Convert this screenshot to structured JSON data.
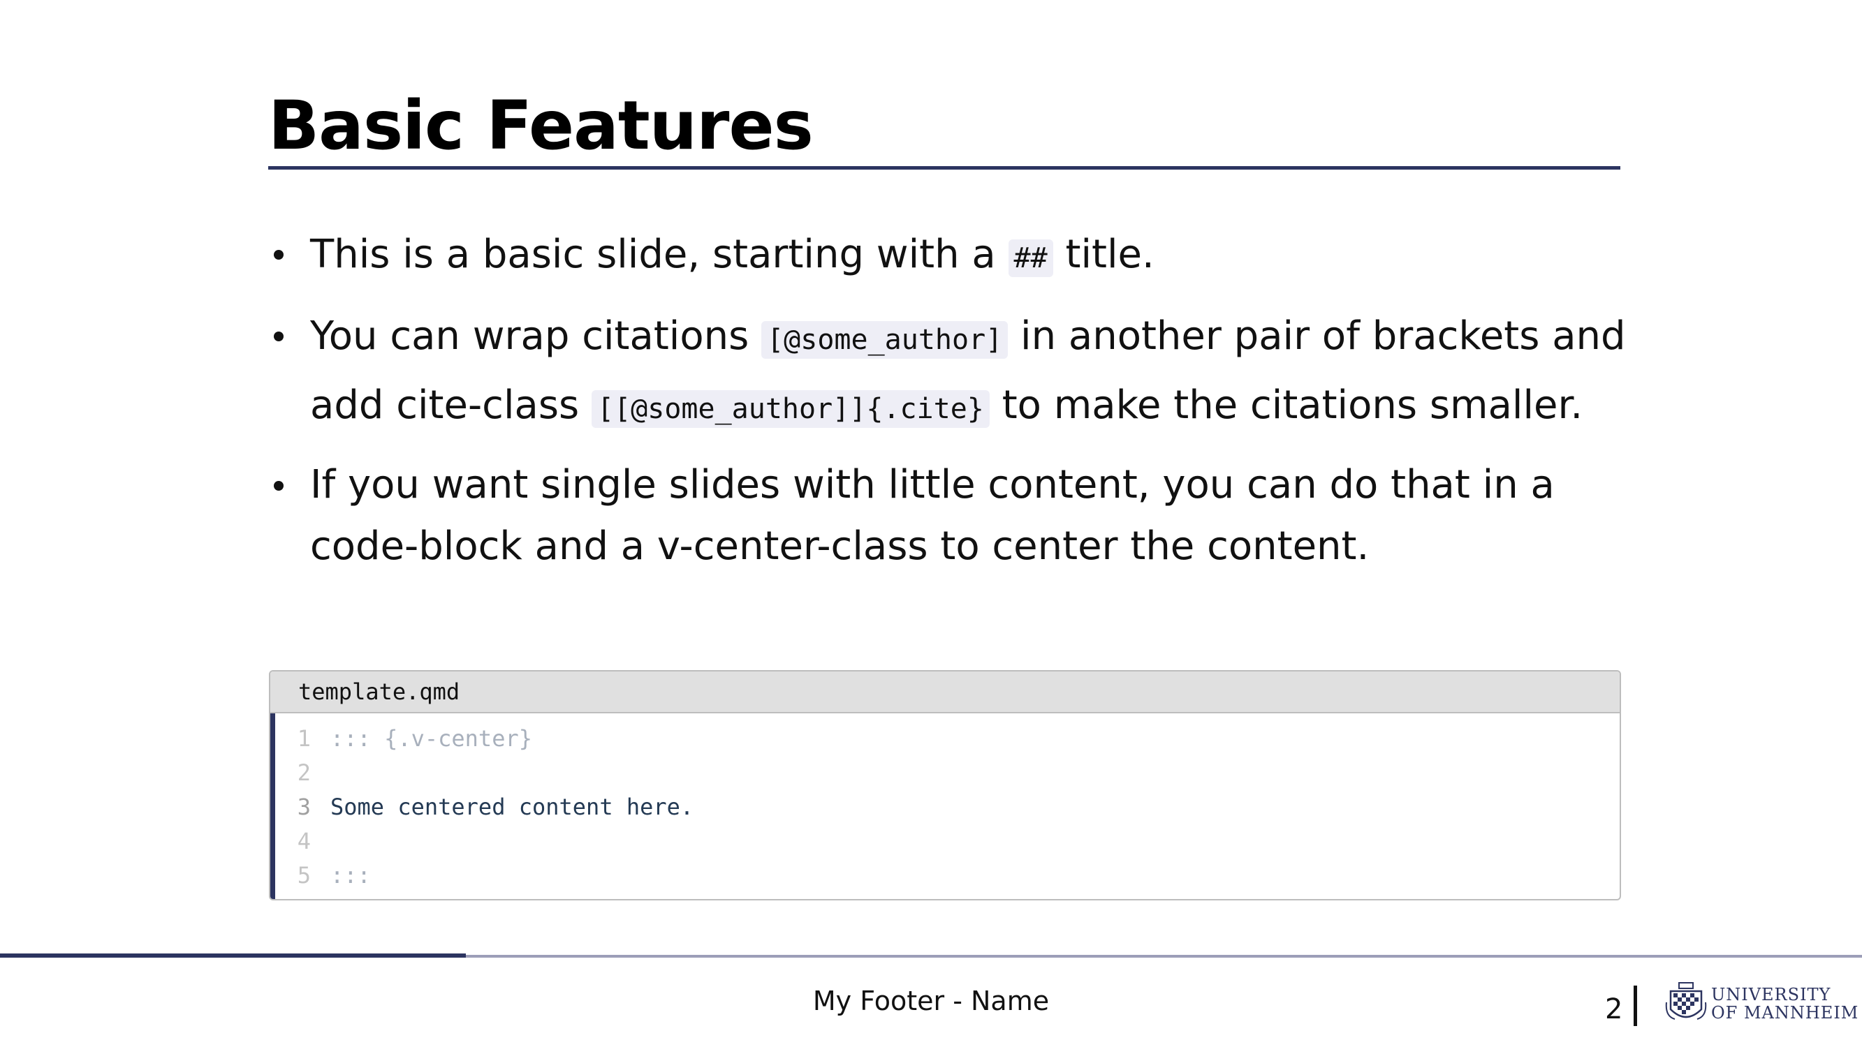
{
  "slide": {
    "title": "Basic Features",
    "bullets": [
      {
        "pre": "This is a basic slide, starting with a ",
        "code": "##",
        "post": " title."
      },
      {
        "pre": "You can wrap citations ",
        "code": "[@some_author]",
        "mid": " in another pair of brackets and add cite-class ",
        "code2": "[[@some_author]]{.cite}",
        "post": " to make the citations smaller."
      },
      {
        "text": "If you want single slides with little content, you can do that in a code-block and a v-center-class to center the content."
      }
    ]
  },
  "code_block": {
    "filename": "template.qmd",
    "lines": [
      {
        "number": "1",
        "text": "::: {.v-center}"
      },
      {
        "number": "2",
        "text": ""
      },
      {
        "number": "3",
        "text": "Some centered content here."
      },
      {
        "number": "4",
        "text": ""
      },
      {
        "number": "5",
        "text": ":::"
      }
    ]
  },
  "footer": {
    "text": "My Footer - Name",
    "slide_number": "2",
    "logo_line1": "UNIVERSITY",
    "logo_line2": "OF MANNHEIM"
  },
  "progress": 0.25,
  "colors": {
    "accent": "#2c3460",
    "progress_track": "#9c9eb8",
    "inline_code_bg": "#eeeef6",
    "code_header_bg": "#e0e0e0"
  }
}
